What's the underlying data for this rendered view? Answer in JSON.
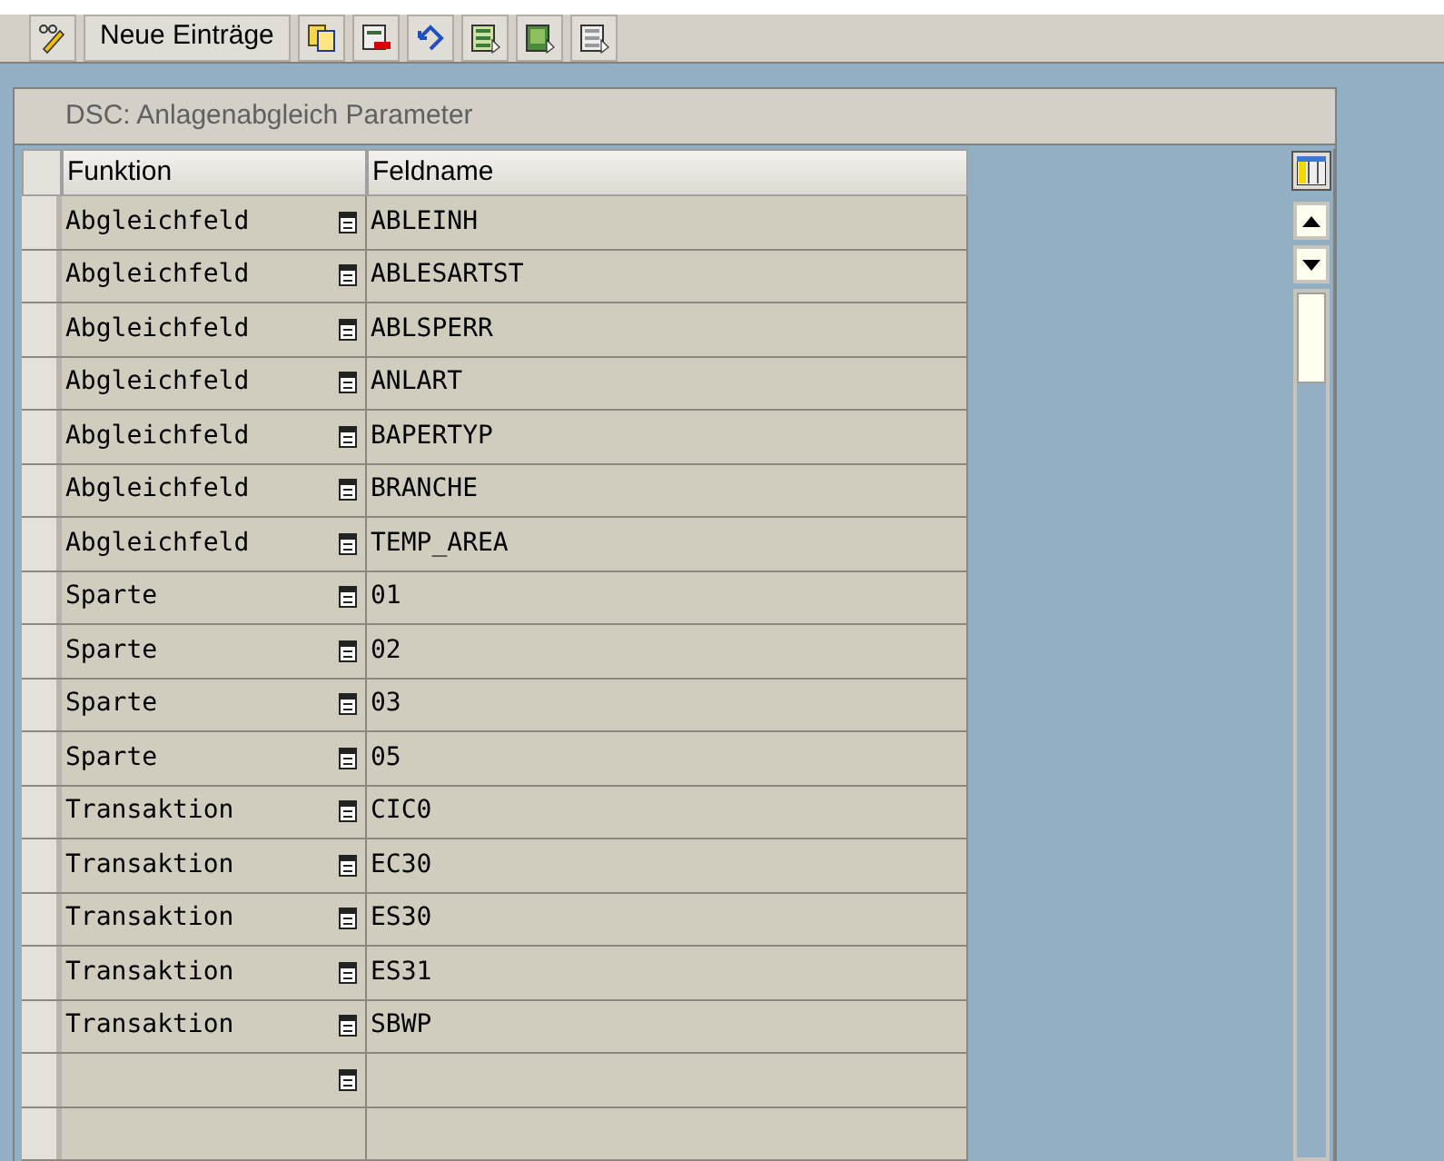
{
  "toolbar": {
    "buttons": [
      {
        "kind": "edit-glasses"
      },
      {
        "kind": "text",
        "label": "Neue Einträge"
      },
      {
        "kind": "copy"
      },
      {
        "kind": "delete"
      },
      {
        "kind": "undo"
      },
      {
        "kind": "select-all"
      },
      {
        "kind": "select-block"
      },
      {
        "kind": "deselect-all"
      }
    ]
  },
  "table": {
    "title": "DSC: Anlagenabgleich Parameter",
    "columns": [
      "Funktion",
      "Feldname"
    ],
    "rows": [
      {
        "kind": "entry",
        "funktion": "Abgleichfeld",
        "feldname": "ABLEINH"
      },
      {
        "kind": "entry",
        "funktion": "Abgleichfeld",
        "feldname": "ABLESARTST"
      },
      {
        "kind": "entry",
        "funktion": "Abgleichfeld",
        "feldname": "ABLSPERR"
      },
      {
        "kind": "entry",
        "funktion": "Abgleichfeld",
        "feldname": "ANLART"
      },
      {
        "kind": "entry",
        "funktion": "Abgleichfeld",
        "feldname": "BAPERTYP"
      },
      {
        "kind": "entry",
        "funktion": "Abgleichfeld",
        "feldname": "BRANCHE"
      },
      {
        "kind": "entry",
        "funktion": "Abgleichfeld",
        "feldname": "TEMP_AREA"
      },
      {
        "kind": "entry",
        "funktion": "Sparte",
        "feldname": "01"
      },
      {
        "kind": "entry",
        "funktion": "Sparte",
        "feldname": "02"
      },
      {
        "kind": "entry",
        "funktion": "Sparte",
        "feldname": "03"
      },
      {
        "kind": "entry",
        "funktion": "Sparte",
        "feldname": "05"
      },
      {
        "kind": "entry",
        "funktion": "Transaktion",
        "feldname": "CIC0"
      },
      {
        "kind": "entry",
        "funktion": "Transaktion",
        "feldname": "EC30"
      },
      {
        "kind": "entry",
        "funktion": "Transaktion",
        "feldname": "ES30"
      },
      {
        "kind": "entry",
        "funktion": "Transaktion",
        "feldname": "ES31"
      },
      {
        "kind": "entry",
        "funktion": "Transaktion",
        "feldname": "SBWP"
      },
      {
        "kind": "empty"
      },
      {
        "kind": "blank"
      }
    ]
  }
}
